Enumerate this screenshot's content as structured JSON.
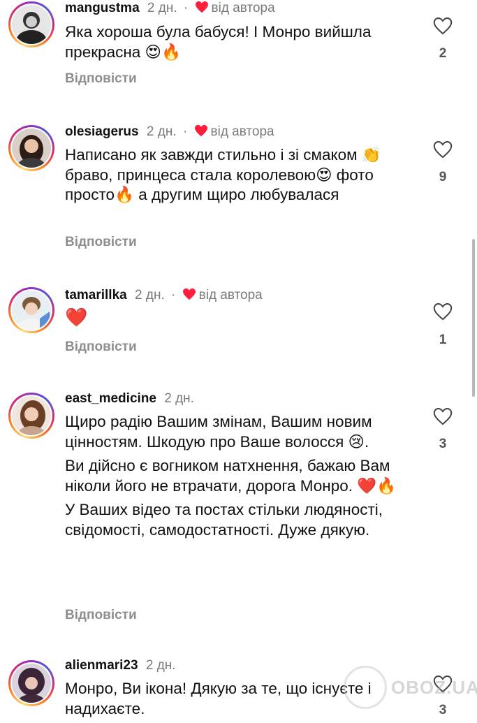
{
  "colors": {
    "heart": "#ff1f3d",
    "meta_gray": "#7a7a7a",
    "reply_gray": "#8e8e8e"
  },
  "comments": [
    {
      "username": "mangustma",
      "time": "2 дн.",
      "liked_by_author": "від автора",
      "lines": [
        "Яка хороша була бабуся! І Монро вийшла прекрасна 😍🔥"
      ],
      "reply": "Відповісти",
      "likes": "2"
    },
    {
      "username": "olesiagerus",
      "time": "2 дн.",
      "liked_by_author": "від автора",
      "lines": [
        "Написано як завжди стильно і зі смаком 👏 браво, принцеса стала королевою😍 фото просто🔥 а другим щиро любувалася"
      ],
      "reply": "Відповісти",
      "likes": "9"
    },
    {
      "username": "tamarillka",
      "time": "2 дн.",
      "liked_by_author": "від автора",
      "lines": [
        "❤️"
      ],
      "reply": "Відповісти",
      "likes": "1"
    },
    {
      "username": "east_medicine",
      "time": "2 дн.",
      "lines": [
        "Щиро радію Вашим змінам, Вашим новим цінностям. Шкодую про Ваше волосся 😢.",
        "Ви дійсно є вогником натхнення, бажаю Вам ніколи його не втрачати, дорога Монро. ❤️🔥",
        "У Ваших відео та постах стільки людяності, свідомості, самодостатності. Дуже дякую."
      ],
      "reply": "Відповісти",
      "likes": "3"
    },
    {
      "username": "alienmari23",
      "time": "2 дн.",
      "lines": [
        "Монро, Ви ікона! Дякую за те, що існуєте і надихаєте."
      ],
      "likes": "3"
    }
  ],
  "watermark": "OBOZ.UA"
}
